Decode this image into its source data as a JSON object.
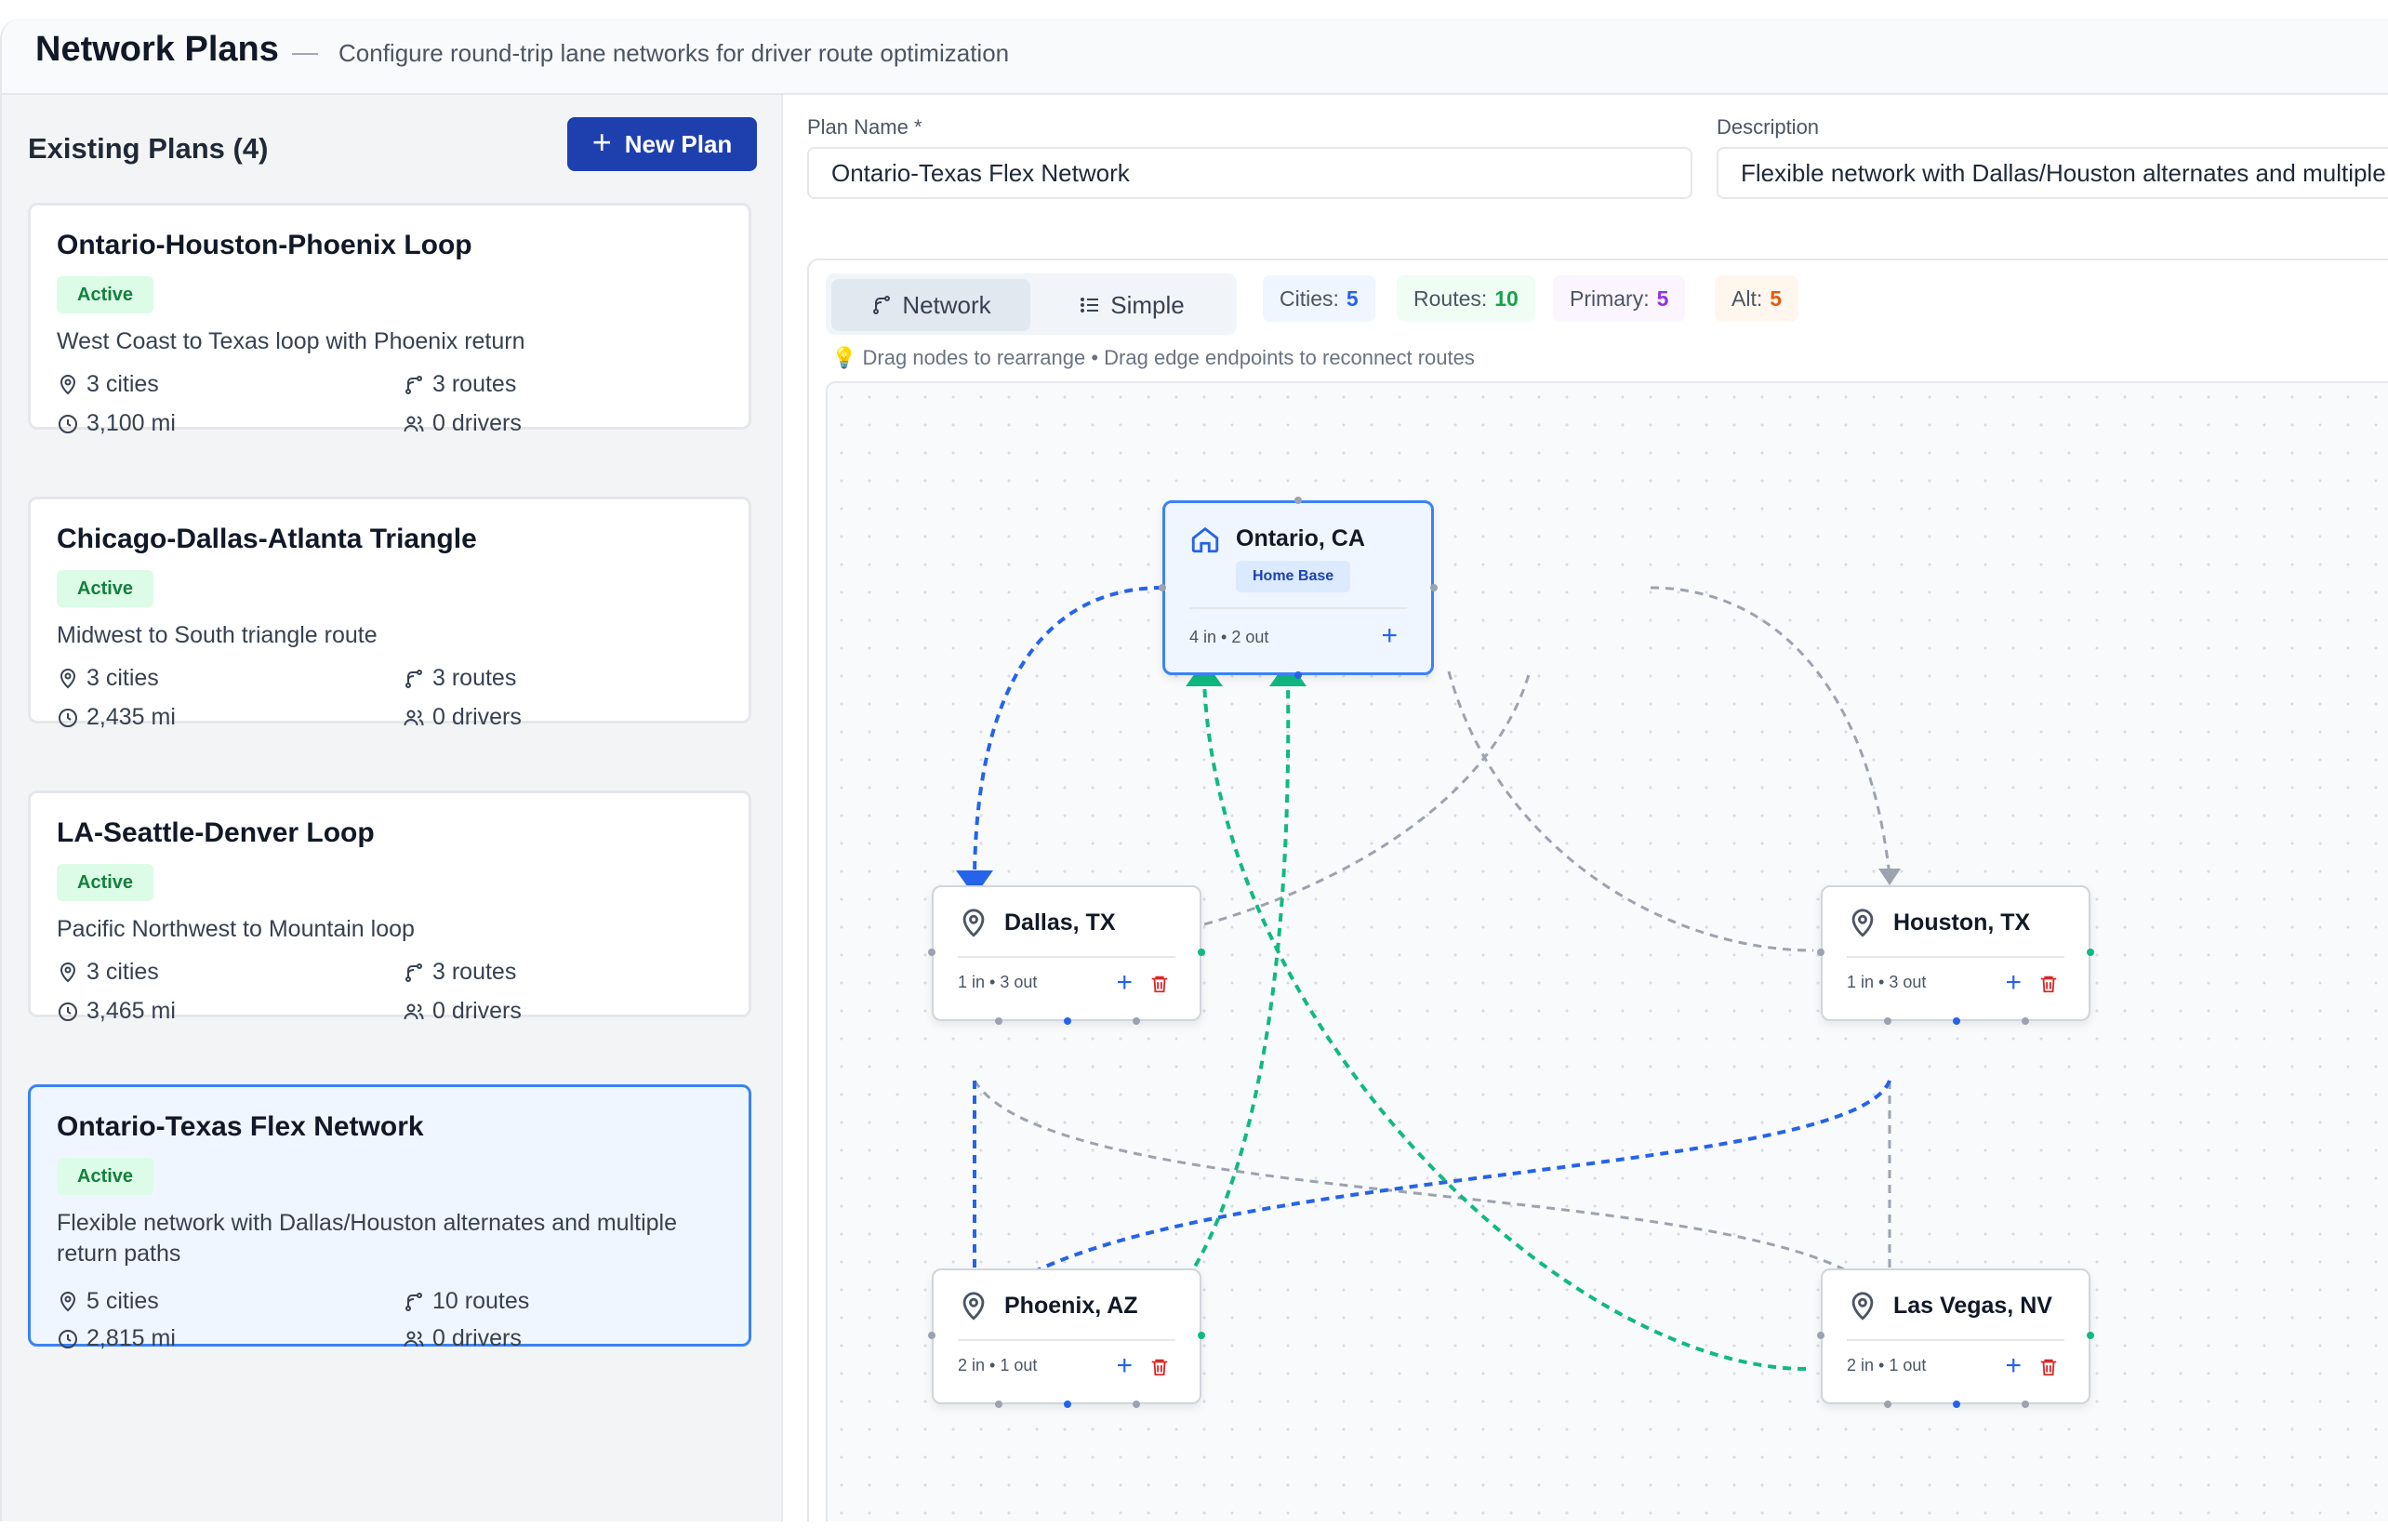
{
  "header": {
    "title": "Network Plans",
    "separator": "—",
    "subtitle": "Configure round-trip lane networks for driver route optimization"
  },
  "sidebar": {
    "heading": "Existing Plans (4)",
    "new_plan_label": "New Plan",
    "plans": [
      {
        "name": "Ontario-Houston-Phoenix Loop",
        "status": "Active",
        "description": "West Coast to Texas loop with Phoenix return",
        "cities": "3 cities",
        "routes": "3 routes",
        "miles": "3,100 mi",
        "drivers": "0 drivers",
        "selected": false
      },
      {
        "name": "Chicago-Dallas-Atlanta Triangle",
        "status": "Active",
        "description": "Midwest to South triangle route",
        "cities": "3 cities",
        "routes": "3 routes",
        "miles": "2,435 mi",
        "drivers": "0 drivers",
        "selected": false
      },
      {
        "name": "LA-Seattle-Denver Loop",
        "status": "Active",
        "description": "Pacific Northwest to Mountain loop",
        "cities": "3 cities",
        "routes": "3 routes",
        "miles": "3,465 mi",
        "drivers": "0 drivers",
        "selected": false
      },
      {
        "name": "Ontario-Texas Flex Network",
        "status": "Active",
        "description": "Flexible network with Dallas/Houston alternates and multiple return paths",
        "cities": "5 cities",
        "routes": "10 routes",
        "miles": "2,815 mi",
        "drivers": "0 drivers",
        "selected": true
      }
    ]
  },
  "form": {
    "plan_name_label": "Plan Name *",
    "plan_name_value": "Ontario-Texas Flex Network",
    "description_label": "Description",
    "description_value": "Flexible network with Dallas/Houston alternates and multiple return paths"
  },
  "view_toggle": {
    "network_label": "Network",
    "simple_label": "Simple",
    "active": "Network"
  },
  "stats": {
    "cities_label": "Cities:",
    "cities_value": "5",
    "routes_label": "Routes:",
    "routes_value": "10",
    "primary_label": "Primary:",
    "primary_value": "5",
    "alt_label": "Alt:",
    "alt_value": "5"
  },
  "hint": "Drag nodes to rearrange • Drag edge endpoints to reconnect routes",
  "nodes": {
    "ontario": {
      "name": "Ontario, CA",
      "badge": "Home Base",
      "stats": "4 in • 2 out",
      "icon": "home-icon"
    },
    "dallas": {
      "name": "Dallas, TX",
      "stats": "1 in • 3 out",
      "icon": "map-pin-icon"
    },
    "houston": {
      "name": "Houston, TX",
      "stats": "1 in • 3 out",
      "icon": "map-pin-icon"
    },
    "phoenix": {
      "name": "Phoenix, AZ",
      "stats": "2 in • 1 out",
      "icon": "map-pin-icon"
    },
    "lasvegas": {
      "name": "Las Vegas, NV",
      "stats": "2 in • 1 out",
      "icon": "map-pin-icon"
    }
  },
  "colors": {
    "primary_blue": "#2563eb",
    "return_green": "#10b981",
    "alternate_gray": "#9ca3af",
    "active_badge": "#15803d",
    "new_plan_button": "#1e40af",
    "delete_red": "#dc2626"
  }
}
